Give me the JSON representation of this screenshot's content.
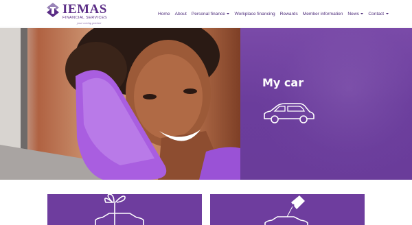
{
  "brand": {
    "name": "IEMAS",
    "subtitle": "FINANCIAL SERVICES",
    "tagline": "your caring partner",
    "color": "#5b2d86"
  },
  "nav": {
    "items": [
      {
        "label": "Home",
        "dropdown": false
      },
      {
        "label": "About",
        "dropdown": false
      },
      {
        "label": "Personal finance",
        "dropdown": true
      },
      {
        "label": "Workplace financing",
        "dropdown": false
      },
      {
        "label": "Rewards",
        "dropdown": false
      },
      {
        "label": "Member information",
        "dropdown": false
      },
      {
        "label": "News",
        "dropdown": true
      },
      {
        "label": "Contact",
        "dropdown": true
      }
    ]
  },
  "hero": {
    "title": "My car",
    "icon": "car-icon",
    "panel_color": "#6e3d9e"
  },
  "cards": [
    {
      "icon": "gift-car-icon"
    },
    {
      "icon": "car-for-sale-tag-icon"
    }
  ]
}
